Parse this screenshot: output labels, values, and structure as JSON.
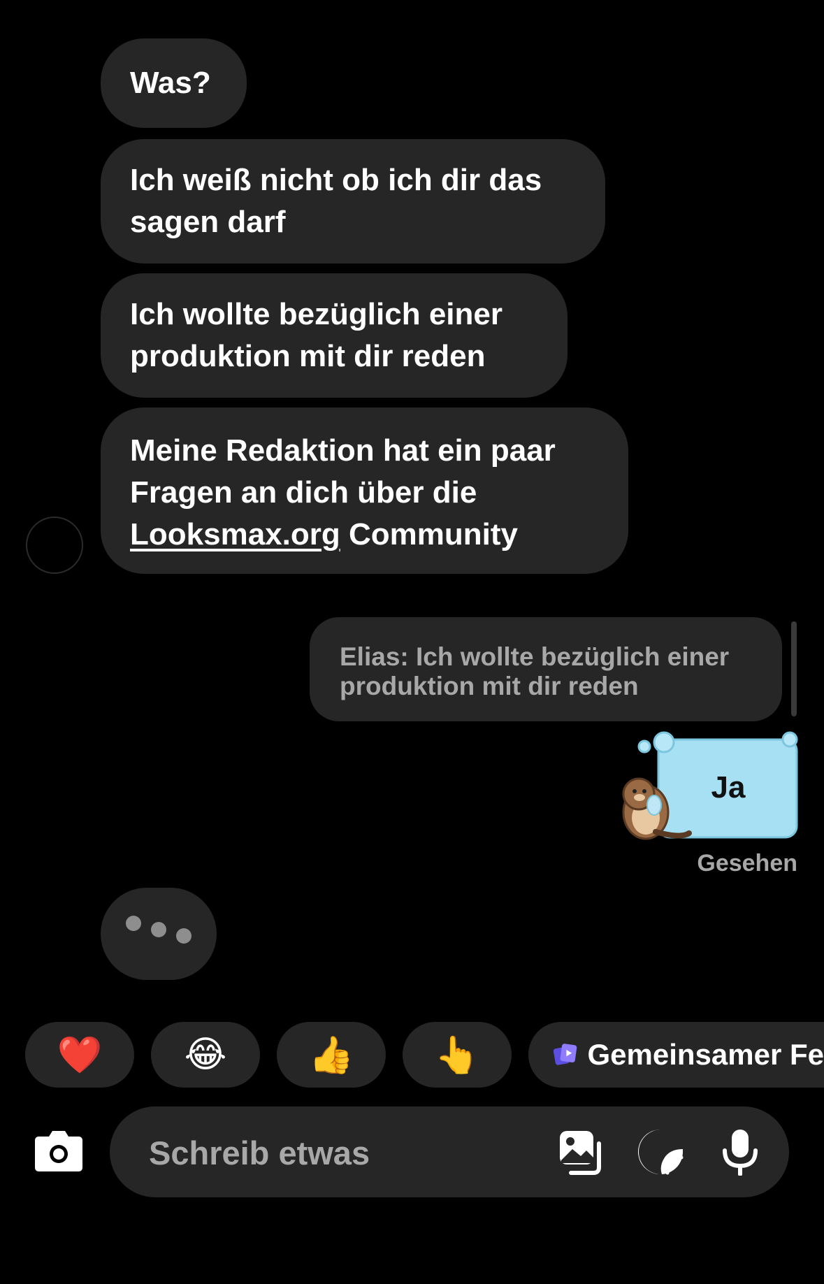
{
  "messages": [
    {
      "text": "Was?"
    },
    {
      "line1": "Ich weiß nicht ob ich dir das",
      "line2": "sagen darf"
    },
    {
      "line1": "Ich wollte bezüglich einer",
      "line2": "produktion mit dir reden"
    },
    {
      "line1": "Meine Redaktion hat ein paar",
      "line2": "Fragen an dich über die",
      "link": "Looksmax.org",
      "line3_rest": " Community"
    }
  ],
  "reply": {
    "line1": "Elias: Ich wollte bezüglich einer",
    "line2": "produktion mit dir reden"
  },
  "sent_sticker": {
    "text": "Ja"
  },
  "status": "Gesehen",
  "quick_reactions": [
    {
      "emoji": "❤️",
      "icon": "heart"
    },
    {
      "emoji": "😂",
      "icon": "tears-of-joy"
    },
    {
      "emoji": "👍",
      "icon": "thumbs-up"
    },
    {
      "emoji": "👆",
      "icon": "pointing-finger"
    }
  ],
  "shared_feature": {
    "label": "Gemeinsamer Fe",
    "icon": "shared-video-icon"
  },
  "composer": {
    "placeholder": "Schreib etwas"
  },
  "colors": {
    "bubble": "#262626",
    "background": "#000000",
    "secondary_text": "#a8a8a8",
    "accent": "#6b5cf0",
    "sticker": "#a7e0f2"
  }
}
